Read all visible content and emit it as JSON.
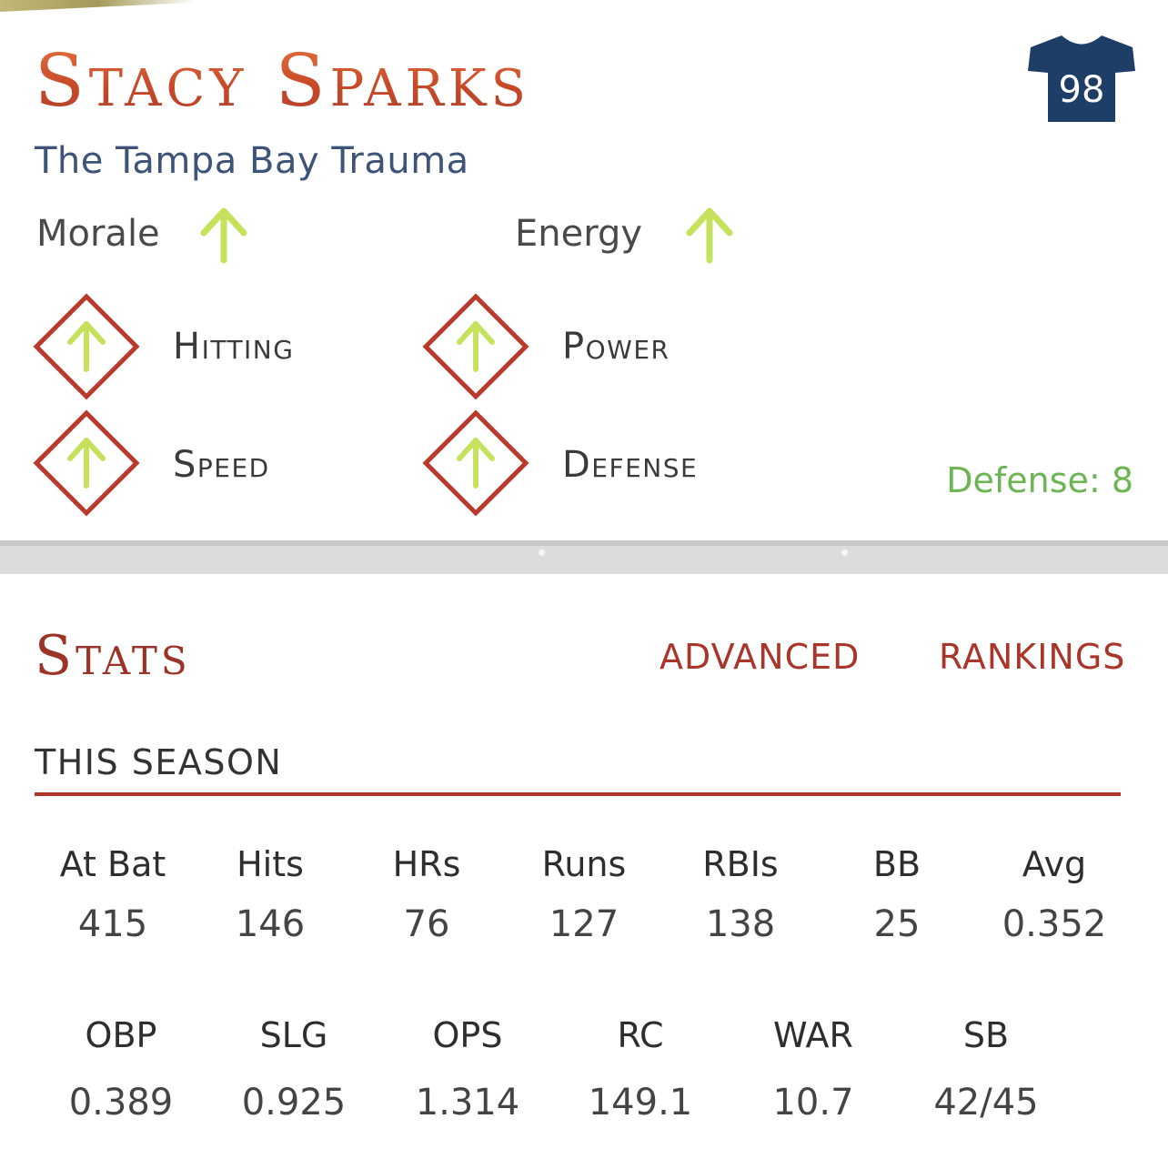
{
  "player": {
    "name": "Stacy Sparks",
    "nickname": "The Tampa Bay Trauma",
    "jersey_number": "98"
  },
  "mood": [
    {
      "label": "Morale",
      "trend": "up"
    },
    {
      "label": "Energy",
      "trend": "up"
    }
  ],
  "skills": [
    {
      "label": "Hitting",
      "trend": "up"
    },
    {
      "label": "Power",
      "trend": "up"
    },
    {
      "label": "Speed",
      "trend": "up"
    },
    {
      "label": "Defense",
      "trend": "up"
    }
  ],
  "defense_readout": "Defense: 8",
  "stats": {
    "title": "Stats",
    "tabs": [
      "ADVANCED",
      "RANKINGS"
    ],
    "period": "THIS SEASON",
    "row1": [
      {
        "label": "At Bat",
        "value": "415"
      },
      {
        "label": "Hits",
        "value": "146"
      },
      {
        "label": "HRs",
        "value": "76"
      },
      {
        "label": "Runs",
        "value": "127"
      },
      {
        "label": "RBIs",
        "value": "138"
      },
      {
        "label": "BB",
        "value": "25"
      },
      {
        "label": "Avg",
        "value": "0.352"
      }
    ],
    "row2": [
      {
        "label": "OBP",
        "value": "0.389"
      },
      {
        "label": "SLG",
        "value": "0.925"
      },
      {
        "label": "OPS",
        "value": "1.314"
      },
      {
        "label": "RC",
        "value": "149.1"
      },
      {
        "label": "WAR",
        "value": "10.7"
      },
      {
        "label": "SB",
        "value": "42/45"
      }
    ]
  },
  "colors": {
    "name_accent": "#d4542c",
    "nickname": "#3d5478",
    "arrow_up": "#c6e25c",
    "diamond_border": "#b83a2c",
    "defense_readout": "#6cb454",
    "stats_accent": "#a8362a",
    "jersey": "#1e3e68"
  },
  "icons": {
    "mood_trend": "arrow-up-icon",
    "skill_badge": "diamond-arrow-up-icon",
    "jersey": "jersey-icon"
  }
}
